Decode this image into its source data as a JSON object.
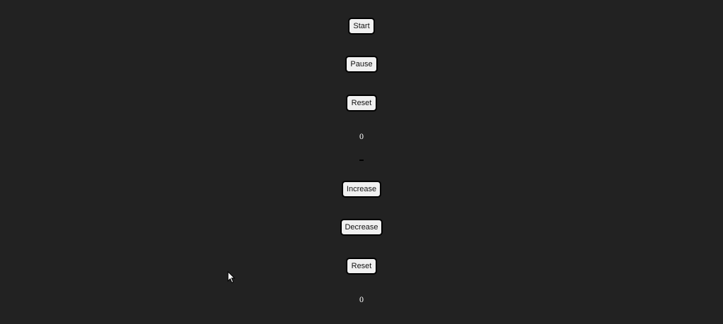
{
  "timer": {
    "start_label": "Start",
    "pause_label": "Pause",
    "reset_label": "Reset",
    "display_value": "0"
  },
  "counter": {
    "increase_label": "Increase",
    "decrease_label": "Decrease",
    "reset_label": "Reset",
    "display_value": "0"
  },
  "colors": {
    "background": "#222222",
    "button_background": "#f0f0f0",
    "button_border": "#000000",
    "value_text": "#ffffff"
  },
  "icons": {
    "cursor": "mouse-pointer-icon"
  }
}
